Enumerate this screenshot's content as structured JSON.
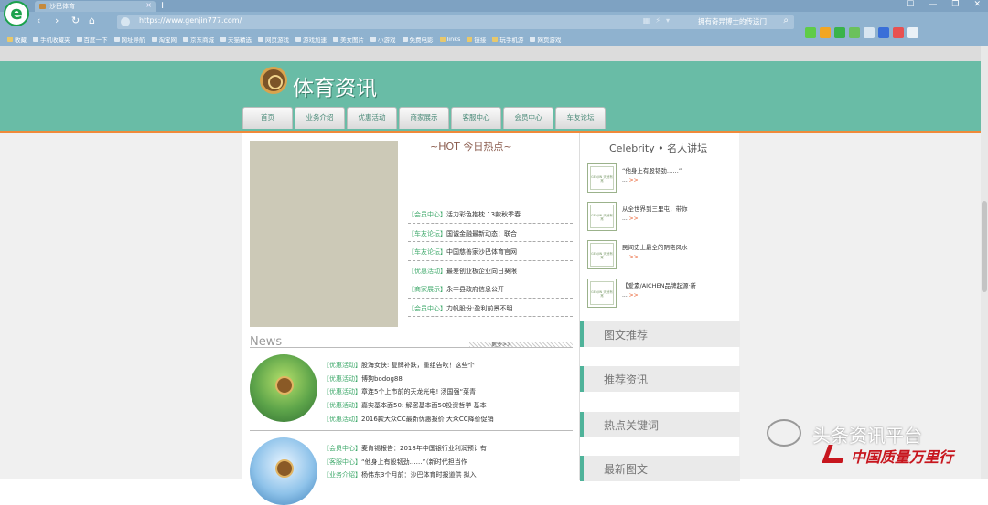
{
  "browser": {
    "tab_title": "沙巴体育",
    "new_tab": "+",
    "url": "https://www.genjin777.com/",
    "address_ad": "拥有奇异博士的传送门",
    "logo_letter": "e",
    "window_controls": [
      "☐",
      "—",
      "❐",
      "✕"
    ],
    "bookmarks": [
      "收藏",
      "手机收藏夹",
      "百度一下",
      "网址导航",
      "淘宝网",
      "京东商城",
      "天猫精选",
      "网页游戏",
      "游戏加速",
      "美女图片",
      "小游戏",
      "免费电影",
      "links",
      "链接",
      "玩手机游",
      "网页游戏"
    ]
  },
  "site": {
    "title": "体育资讯",
    "menu": [
      "首页",
      "业务介绍",
      "优惠活动",
      "商家展示",
      "客服中心",
      "会员中心",
      "车友论坛"
    ],
    "hot_title": "HOT 今日热点",
    "hot_list": [
      {
        "cat": "【会员中心】",
        "text": "活力彩色抱枕 13款秋季春"
      },
      {
        "cat": "【车友论坛】",
        "text": "国诚金融最新动态：联合"
      },
      {
        "cat": "【车友论坛】",
        "text": "中国慈善家沙巴体育官网"
      },
      {
        "cat": "【优惠活动】",
        "text": "最差创业板企业向日葵限"
      },
      {
        "cat": "【商家展示】",
        "text": "永丰县政府信息公开"
      },
      {
        "cat": "【会员中心】",
        "text": "力帆股份:盈利前景不明"
      }
    ],
    "news_title": "News",
    "more": "更多>>",
    "news_group1": [
      {
        "cat": "【优惠活动】",
        "text": "股海女侠: 复牌补跌，重组告吹！这些个"
      },
      {
        "cat": "【优惠活动】",
        "text": "博狗bodog88"
      },
      {
        "cat": "【优惠活动】",
        "text": "章连5个上市前的天龙光电! 汤国强“菜青"
      },
      {
        "cat": "【优惠活动】",
        "text": "嘉实基本面50: 解密基本面50投资哲学 基本"
      },
      {
        "cat": "【优惠活动】",
        "text": "2016款大众CC最新优惠报价 大众CC降价促销"
      }
    ],
    "news_group2": [
      {
        "cat": "【会员中心】",
        "text": "麦肯锡报告：2018年中国银行业利润预计有"
      },
      {
        "cat": "【客服中心】",
        "text": "“他身上有股韧劲……”（新时代担当作"
      },
      {
        "cat": "【业务介绍】",
        "text": "杨伟东3个月前：沙巴体育时报道供 拟入"
      }
    ],
    "celebrity_title": "Celebrity • 名人讲坛",
    "celebrity": [
      {
        "text": "“他身上有股韧劲……”",
        "dots": "...",
        "more": ">>"
      },
      {
        "text": "从全世界到三里屯，带你",
        "dots": "...",
        "more": ">>"
      },
      {
        "text": "民间史上最全的阴宅风水",
        "dots": "...",
        "more": ">>"
      },
      {
        "text": "【爱素/AICHEN品牌起源·新",
        "dots": "...",
        "more": ">>"
      }
    ],
    "thumb_label": "GENJIN 天地有常",
    "side_sections": [
      "图文推荐",
      "推荐资讯",
      "热点关键词",
      "最新图文"
    ]
  },
  "watermark": {
    "line1": "头条资讯平台",
    "line2": "中国质量万里行"
  }
}
